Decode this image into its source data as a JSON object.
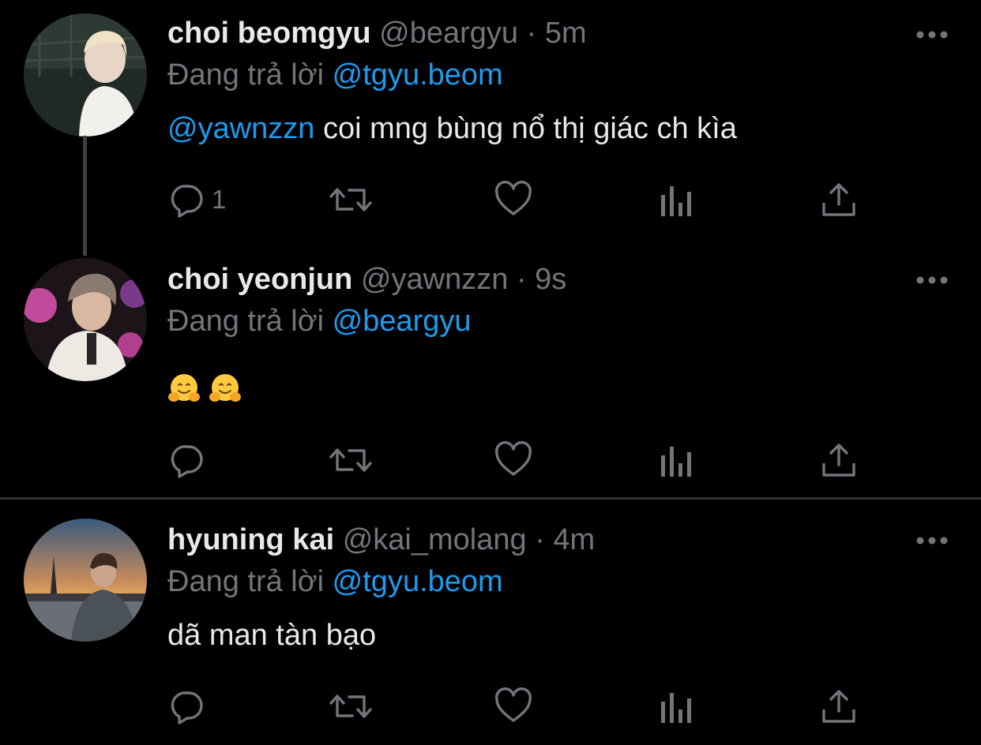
{
  "tweets": [
    {
      "name": "choi beomgyu",
      "handle": "@beargyu",
      "separator": "·",
      "time": "5m",
      "reply_prefix": "Đang trả lời",
      "reply_to": "@tgyu.beom",
      "mention": "@yawnzzn",
      "text": " coi mng bùng nổ thị giác ch kìa",
      "reply_count": "1"
    },
    {
      "name": "choi yeonjun",
      "handle": "@yawnzzn",
      "separator": "·",
      "time": "9s",
      "reply_prefix": "Đang trả lời",
      "reply_to": "@beargyu",
      "text": "",
      "emojis": [
        "hugging-face-emoji",
        "hugging-face-emoji"
      ],
      "reply_count": ""
    },
    {
      "name": "hyuning kai",
      "handle": "@kai_molang",
      "separator": "·",
      "time": "4m",
      "reply_prefix": "Đang trả lời",
      "reply_to": "@tgyu.beom",
      "text": "dã man tàn bạo",
      "reply_count": ""
    }
  ],
  "icons": {
    "reply": "speech-bubble-icon",
    "retweet": "retweet-arrows-icon",
    "like": "heart-icon",
    "views": "bar-chart-icon",
    "share": "share-upload-icon",
    "more": "ellipsis-icon"
  },
  "colors": {
    "background": "#000000",
    "text": "#e7e9ea",
    "secondary": "#71767b",
    "accent": "#1d9bf0",
    "divider": "#2f3336"
  }
}
